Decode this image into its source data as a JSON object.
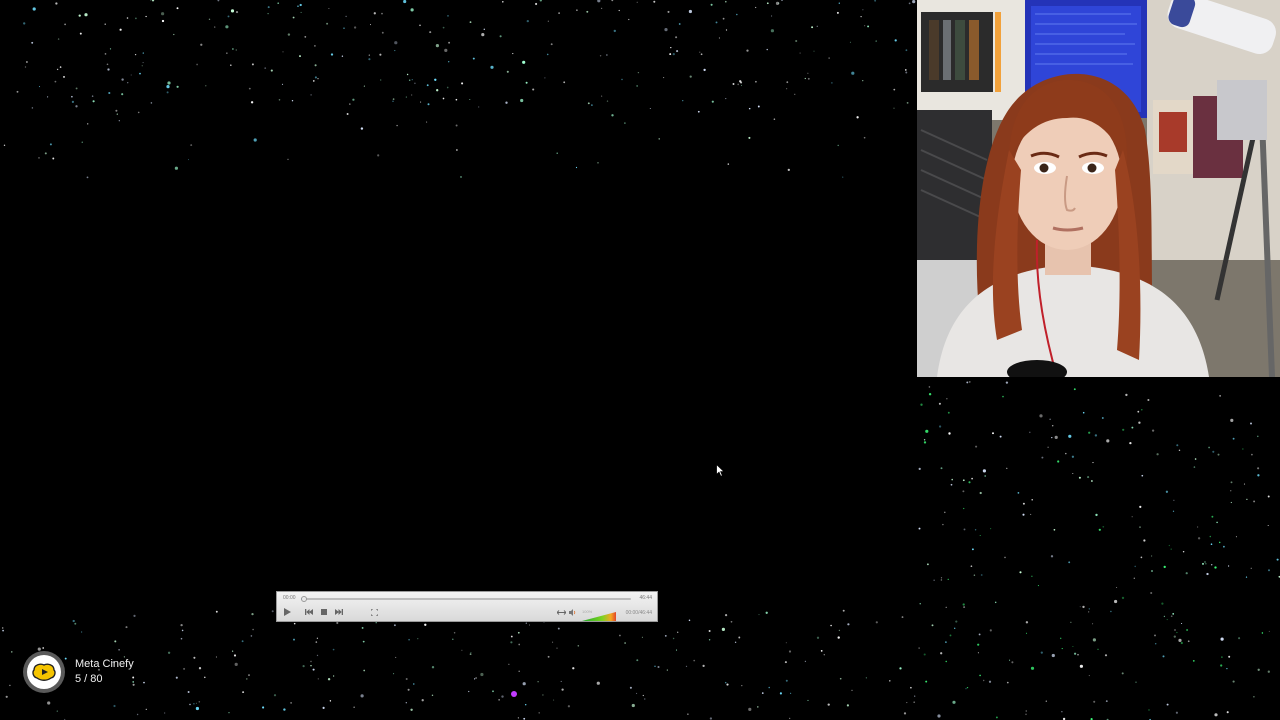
{
  "player": {
    "time_start": "00:00",
    "time_total": "46:44",
    "elapsed": "00:00/46:44",
    "volume_percent": "100%",
    "progress": 0.01,
    "volume_level": 1.0
  },
  "badge": {
    "title": "Meta Cinefy",
    "count": "5 / 80"
  },
  "icons": [
    "play-icon",
    "previous-icon",
    "stop-icon",
    "next-icon",
    "fullscreen-icon",
    "stretch-icon",
    "volume-icon",
    "mouse-cursor-icon",
    "cinefy-logo-icon"
  ],
  "colors": {
    "background": "#000000",
    "player_bg": "#e4e4e4",
    "logo_yellow": "#f5c400"
  }
}
